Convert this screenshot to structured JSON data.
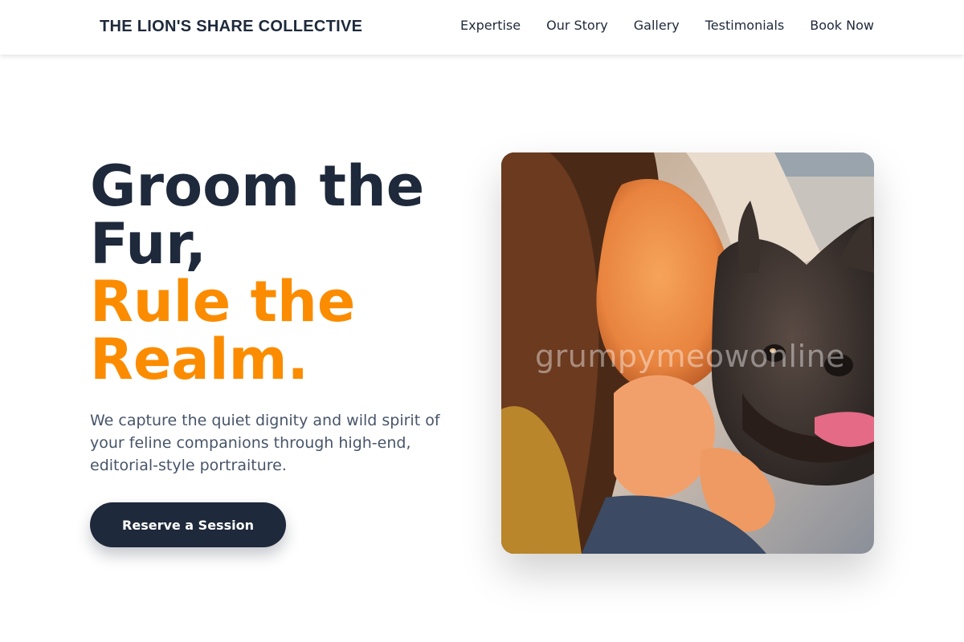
{
  "header": {
    "brand": "THE LION'S SHARE COLLECTIVE",
    "nav": [
      {
        "label": "Expertise"
      },
      {
        "label": "Our Story"
      },
      {
        "label": "Gallery"
      },
      {
        "label": "Testimonials"
      },
      {
        "label": "Book Now"
      }
    ]
  },
  "hero": {
    "title_line1": "Groom the",
    "title_line2": "Fur,",
    "title_accent_line1": "Rule the",
    "title_accent_line2": "Realm.",
    "subtitle": "We capture the quiet dignity and wild spirit of your feline companions through high-end, editorial-style portraiture.",
    "cta_label": "Reserve a Session",
    "image_watermark": "grumpymeowonline"
  },
  "colors": {
    "primary_dark": "#1e293b",
    "accent_orange": "#fb8c00",
    "body_text": "#475569"
  }
}
